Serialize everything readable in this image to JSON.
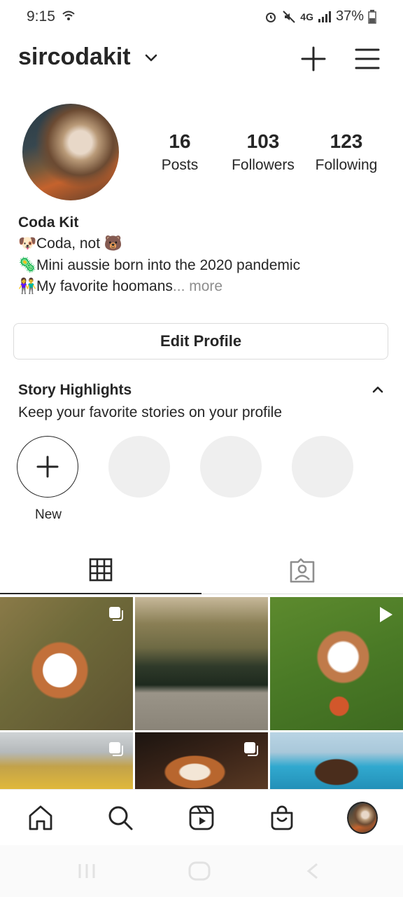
{
  "status_bar": {
    "time": "9:15",
    "battery": "37%",
    "network": "4G"
  },
  "header": {
    "username": "sircodakit"
  },
  "profile": {
    "stats": [
      {
        "num": "16",
        "label": "Posts"
      },
      {
        "num": "103",
        "label": "Followers"
      },
      {
        "num": "123",
        "label": "Following"
      }
    ],
    "name": "Coda Kit",
    "bio": [
      {
        "emoji": "🐶",
        "text": "Coda, not "
      },
      {
        "emoji": "🦠",
        "text": "Mini aussie born into the 2020 pandemic"
      },
      {
        "emoji": "👫",
        "text": "My favorite hoomans"
      }
    ],
    "bio_trailing_emoji": "🐻",
    "more": "... more",
    "edit_button": "Edit Profile"
  },
  "highlights": {
    "title": "Story Highlights",
    "subtitle": "Keep your favorite stories on your profile",
    "new_label": "New"
  },
  "icons": {
    "wifi": "wifi-icon",
    "dropdown": "chevron-down-icon",
    "create": "plus-icon",
    "menu": "hamburger-menu-icon",
    "grid": "grid-icon",
    "tagged": "tagged-person-icon",
    "home": "home-icon",
    "search": "search-icon",
    "reels": "reels-icon",
    "shop": "shopping-bag-icon"
  },
  "colors": {
    "text": "#262626",
    "muted": "#8e8e8e",
    "border": "#dbdbdb",
    "placeholder": "#efefef"
  }
}
